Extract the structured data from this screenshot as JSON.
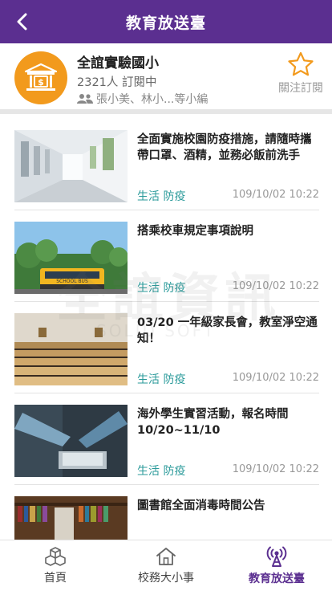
{
  "header": {
    "title": "教育放送臺",
    "back_icon": "chevron-left-icon"
  },
  "channel": {
    "name": "全誼實驗國小",
    "subscribers": "2321人 訂閱中",
    "editors": "張小美、林小...等小編",
    "follow_label": "關注訂閱",
    "logo_icon": "bank-icon",
    "accent": "#f29a1d"
  },
  "feed": {
    "items": [
      {
        "title": "全面實施校園防疫措施，請隨時攜帶口罩、酒精，並務必飯前洗手",
        "tags": "生活 防疫",
        "time": "109/10/02 10:22"
      },
      {
        "title": "搭乘校車規定事項說明",
        "tags": "生活 防疫",
        "time": "109/10/02 10:22"
      },
      {
        "title": "03/20 一年級家長會，教室淨空通知！",
        "tags": "生活 防疫",
        "time": "109/10/02 10:22"
      },
      {
        "title": "海外學生實習活動，報名時間 10/20~11/10",
        "tags": "生活 防疫",
        "time": "109/10/02 10:22"
      },
      {
        "title": "圖書館全面消毒時間公告",
        "tags": "",
        "time": ""
      }
    ]
  },
  "watermark": {
    "text": "全誼資訊",
    "sub": "SOLID SOFT"
  },
  "nav": {
    "items": [
      {
        "label": "首頁",
        "icon": "cubes-icon"
      },
      {
        "label": "校務大小事",
        "icon": "home-icon"
      },
      {
        "label": "教育放送臺",
        "icon": "broadcast-icon"
      }
    ],
    "active_color": "#5b2f90"
  },
  "colors": {
    "brand": "#5b2f90",
    "tag": "#2a9a9a"
  }
}
